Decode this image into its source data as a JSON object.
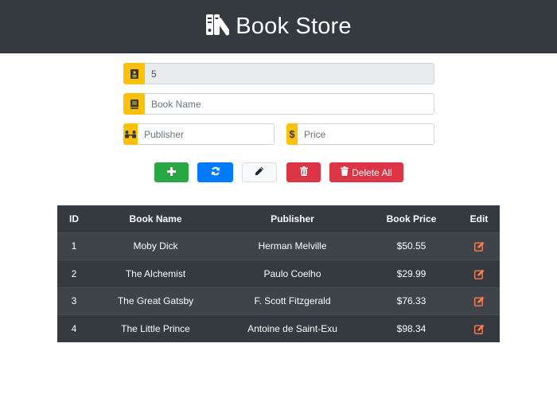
{
  "header": {
    "title": "Book Store",
    "logo_icon": "books-icon"
  },
  "form": {
    "id_value": "5",
    "book_name_placeholder": "Book Name",
    "publisher_placeholder": "Publisher",
    "price_placeholder": "Price"
  },
  "buttons": {
    "add_icon": "plus-icon",
    "refresh_icon": "sync-icon",
    "edit_icon": "pencil-icon",
    "delete_icon": "trash-icon",
    "delete_all_label": "Delete All"
  },
  "table": {
    "headers": [
      "ID",
      "Book Name",
      "Publisher",
      "Book Price",
      "Edit"
    ],
    "rows": [
      [
        "1",
        "Moby Dick",
        "Herman Melville",
        "$50.55"
      ],
      [
        "2",
        "The Alchemist",
        "Paulo Coelho",
        "$29.99"
      ],
      [
        "3",
        "The Great Gatsby",
        "F. Scott Fitzgerald",
        "$76.33"
      ],
      [
        "4",
        "The Little Prince",
        "Antoine de Saint-Exu",
        "$98.34"
      ]
    ]
  },
  "colors": {
    "header_bg": "#343a40",
    "accent": "#ffc107",
    "success": "#28a745",
    "primary": "#007bff",
    "danger": "#dc3545",
    "edit_icon": "#fd7e4f"
  }
}
